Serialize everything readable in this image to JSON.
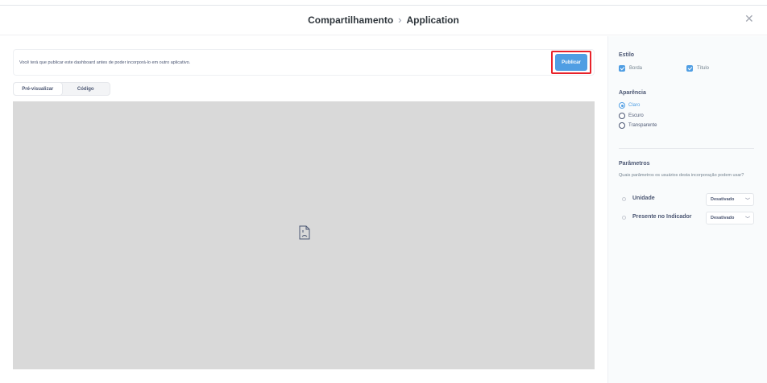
{
  "header": {
    "breadcrumb_parent": "Compartilhamento",
    "breadcrumb_separator": "›",
    "breadcrumb_current": "Application",
    "close_icon": "close-icon"
  },
  "notice": {
    "text": "Você terá que publicar este dashboard antes de poder incorporá-lo em outro aplicativo.",
    "publish_label": "Publicar"
  },
  "view_toggle": {
    "options": [
      "Pré-visualizar",
      "Código"
    ],
    "selected": "Pré-visualizar"
  },
  "preview": {
    "icon": "broken-document-icon",
    "background": "#d9d9d9"
  },
  "sidebar": {
    "style": {
      "title": "Estilo",
      "options": [
        {
          "label": "Borda",
          "checked": true
        },
        {
          "label": "Título",
          "checked": true
        }
      ]
    },
    "appearance": {
      "title": "Aparência",
      "options": [
        {
          "label": "Claro",
          "selected": true
        },
        {
          "label": "Escuro",
          "selected": false
        },
        {
          "label": "Transparente",
          "selected": false
        }
      ]
    },
    "parameters": {
      "title": "Parâmetros",
      "description": "Quais parâmetros os usuários desta incorporação podem usar?",
      "items": [
        {
          "name": "Unidade",
          "value": "Desativado"
        },
        {
          "name": "Presente no Indicador",
          "value": "Desativado"
        }
      ]
    }
  },
  "colors": {
    "accent": "#509ee3",
    "highlight": "#e8222a",
    "text": "#4c5773"
  }
}
